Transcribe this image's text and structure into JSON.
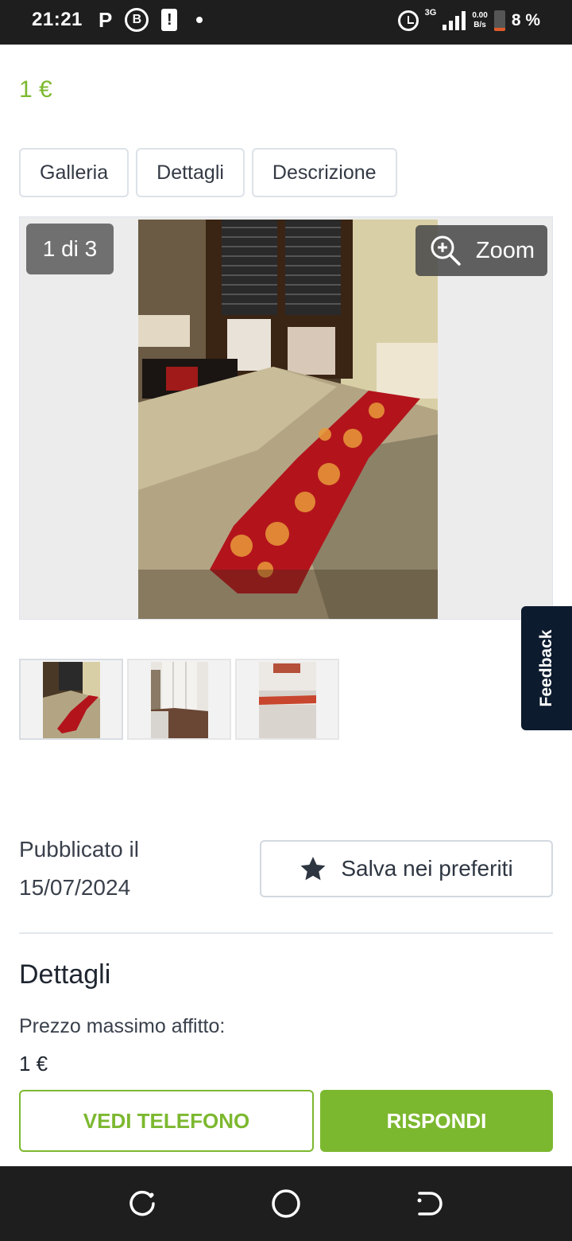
{
  "status_bar": {
    "time": "21:21",
    "p_icon": "P",
    "b_icon": "B",
    "alert_icon": "!",
    "network": "3G",
    "speed_top": "0.00",
    "speed_bottom": "B/s",
    "battery": "8 %"
  },
  "listing": {
    "price": "1 €"
  },
  "tabs": [
    {
      "label": "Galleria"
    },
    {
      "label": "Dettagli"
    },
    {
      "label": "Descrizione"
    }
  ],
  "gallery": {
    "counter": "1 di 3",
    "zoom_label": "Zoom"
  },
  "feedback": {
    "label": "Feedback"
  },
  "publication": {
    "label": "Pubblicato il",
    "date": "15/07/2024"
  },
  "save": {
    "label": "Salva nei preferiti"
  },
  "details": {
    "title": "Dettagli",
    "max_rent_label": "Prezzo massimo affitto:",
    "max_rent_value": "1 €"
  },
  "actions": {
    "phone_label": "VEDI TELEFONO",
    "reply_label": "RISPONDI"
  },
  "colors": {
    "accent": "#7cb82f",
    "navy": "#0d1b2e"
  }
}
